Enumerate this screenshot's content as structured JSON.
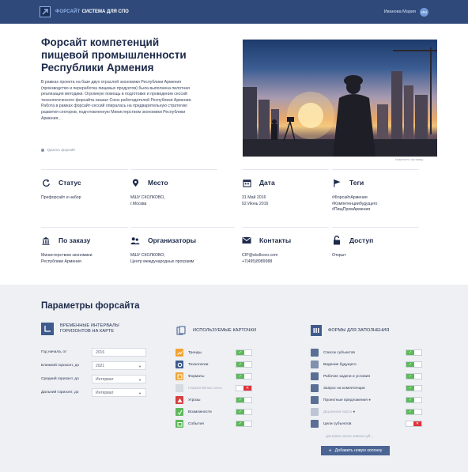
{
  "topbar": {
    "brand_accent": "ФОРСАЙТ",
    "brand_main": "СИСТЕМА ДЛЯ СПО",
    "user_name": "Иванова Мария",
    "avatar_initials": "ИМ"
  },
  "hero": {
    "title": "Форсайт компетенций пищевой промышленности Республики Армения",
    "description": "В рамках проекта на базе двух отраслей экономики Республики Армения (производство и переработка пищевых продуктов) была выполнена пилотная реализация методики. Огромную помощь в подготовке и проведении сессий технологического форсайта оказал Союз работодателей Республики Армения. Работа в рамках форсайт-сессий опиралась на предварительную стратегию развития секторов, подготовленную Министерством экономики Республики Армения...",
    "link": "Удалить форсайт",
    "photo_caption": "Изменить заставку"
  },
  "info": [
    {
      "icon": "refresh-icon",
      "label": "Статус",
      "value": "Префорсайт и набор"
    },
    {
      "icon": "location-pin-icon",
      "label": "Место",
      "value": "МШУ СКОЛКОВО,\nг.Москва"
    },
    {
      "icon": "calendar-icon",
      "label": "Дата",
      "value": "31 Май 2016\n02 Июнь 2016"
    },
    {
      "icon": "flag-icon",
      "label": "Теги",
      "value": "#ФорсайтАрмения\n#Компетенциибудущего\n#ПищПромАрмения"
    },
    {
      "icon": "bank-icon",
      "label": "По заказу",
      "value": "Министерством экономики\nРеспублики Армения"
    },
    {
      "icon": "people-icon",
      "label": "Организаторы",
      "value": "МШУ СКОЛКОВО,\nЦентр международных программ"
    },
    {
      "icon": "envelope-icon",
      "label": "Контакты",
      "value": "CIP@skolkovo.com\n+7(495)8989988"
    },
    {
      "icon": "unlock-icon",
      "label": "Доступ",
      "value": "Открыт"
    }
  ],
  "params": {
    "title": "Параметры форсайта",
    "intervals": {
      "heading": "ВРЕМЕННЫЕ ИНТЕРВАЛЫ\nГОРИЗОНТОВ НА КАРТЕ",
      "fields": [
        {
          "label": "Год начала, от",
          "value": "2016",
          "dropdown": false
        },
        {
          "label": "Ближний горизонт, до",
          "value": "2021",
          "dropdown": true
        },
        {
          "label": "Средний горизонт, до",
          "value": "Интервал",
          "dropdown": true
        },
        {
          "label": "Дальний горизонт, до",
          "value": "Интервал",
          "dropdown": true
        }
      ]
    },
    "cards": {
      "heading": "ИСПОЛЬЗУЕМЫЕ КАРТОЧКИ",
      "items": [
        {
          "label": "Тренды",
          "icon": "trend-icon",
          "color": "#f0a434",
          "enabled": true,
          "dim": false
        },
        {
          "label": "Технологии",
          "icon": "gear-icon",
          "color": "#3f5b8c",
          "enabled": true,
          "dim": false
        },
        {
          "label": "Форматы",
          "icon": "format-icon",
          "color": "#f0a434",
          "enabled": true,
          "dim": false
        },
        {
          "label": "Нормативные акты",
          "icon": "document-icon",
          "color": "#b9bfca",
          "enabled": false,
          "dim": true
        },
        {
          "label": "Угрозы",
          "icon": "warning-icon",
          "color": "#d73d3d",
          "enabled": true,
          "dim": false
        },
        {
          "label": "Возможности",
          "icon": "opportunity-icon",
          "color": "#5db85b",
          "enabled": true,
          "dim": false
        },
        {
          "label": "События",
          "icon": "event-icon",
          "color": "#5db85b",
          "enabled": true,
          "dim": false
        }
      ]
    },
    "forms": {
      "heading": "ФОРМЫ ДЛЯ ЗАПОЛНЕНИЯ",
      "items": [
        {
          "label": "Список субъектов",
          "icon": "subjects-icon",
          "enabled": true,
          "dim": false,
          "info": false
        },
        {
          "label": "Видение будущего",
          "icon": "vision-icon",
          "enabled": true,
          "dim": false,
          "info": false
        },
        {
          "label": "Рабочие задачи и условия",
          "icon": "tasks-icon",
          "enabled": true,
          "dim": false,
          "info": false
        },
        {
          "label": "Запрос на компетенции",
          "icon": "request-icon",
          "enabled": true,
          "dim": false,
          "info": false
        },
        {
          "label": "Проектные предложения",
          "icon": "proposals-icon",
          "enabled": true,
          "dim": false,
          "info": true
        },
        {
          "label": "Дорожная карта",
          "icon": "roadmap-icon",
          "enabled": true,
          "dim": true,
          "info": true
        },
        {
          "label": "Цели субъектов",
          "icon": "goals-icon",
          "enabled": false,
          "dim": false,
          "info": false
        }
      ],
      "hint": "доступно после списка суб...",
      "add_button": "Добавить новую колонку"
    },
    "colors": {
      "accent": "#4a6594",
      "toggle_on": "#5db85b",
      "toggle_off": "#e0323a"
    }
  }
}
